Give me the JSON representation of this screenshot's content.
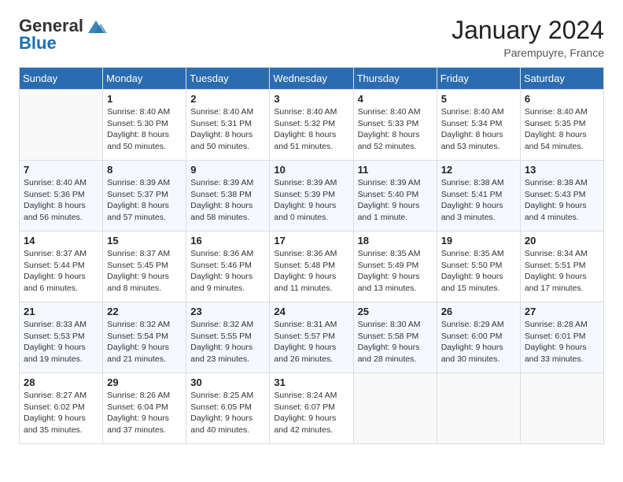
{
  "header": {
    "logo_general": "General",
    "logo_blue": "Blue",
    "month_year": "January 2024",
    "location": "Parempuyre, France"
  },
  "days_of_week": [
    "Sunday",
    "Monday",
    "Tuesday",
    "Wednesday",
    "Thursday",
    "Friday",
    "Saturday"
  ],
  "weeks": [
    [
      {
        "day": "",
        "sunrise": "",
        "sunset": "",
        "daylight": ""
      },
      {
        "day": "1",
        "sunrise": "Sunrise: 8:40 AM",
        "sunset": "Sunset: 5:30 PM",
        "daylight": "Daylight: 8 hours and 50 minutes."
      },
      {
        "day": "2",
        "sunrise": "Sunrise: 8:40 AM",
        "sunset": "Sunset: 5:31 PM",
        "daylight": "Daylight: 8 hours and 50 minutes."
      },
      {
        "day": "3",
        "sunrise": "Sunrise: 8:40 AM",
        "sunset": "Sunset: 5:32 PM",
        "daylight": "Daylight: 8 hours and 51 minutes."
      },
      {
        "day": "4",
        "sunrise": "Sunrise: 8:40 AM",
        "sunset": "Sunset: 5:33 PM",
        "daylight": "Daylight: 8 hours and 52 minutes."
      },
      {
        "day": "5",
        "sunrise": "Sunrise: 8:40 AM",
        "sunset": "Sunset: 5:34 PM",
        "daylight": "Daylight: 8 hours and 53 minutes."
      },
      {
        "day": "6",
        "sunrise": "Sunrise: 8:40 AM",
        "sunset": "Sunset: 5:35 PM",
        "daylight": "Daylight: 8 hours and 54 minutes."
      }
    ],
    [
      {
        "day": "7",
        "sunrise": "Sunrise: 8:40 AM",
        "sunset": "Sunset: 5:36 PM",
        "daylight": "Daylight: 8 hours and 56 minutes."
      },
      {
        "day": "8",
        "sunrise": "Sunrise: 8:39 AM",
        "sunset": "Sunset: 5:37 PM",
        "daylight": "Daylight: 8 hours and 57 minutes."
      },
      {
        "day": "9",
        "sunrise": "Sunrise: 8:39 AM",
        "sunset": "Sunset: 5:38 PM",
        "daylight": "Daylight: 8 hours and 58 minutes."
      },
      {
        "day": "10",
        "sunrise": "Sunrise: 8:39 AM",
        "sunset": "Sunset: 5:39 PM",
        "daylight": "Daylight: 9 hours and 0 minutes."
      },
      {
        "day": "11",
        "sunrise": "Sunrise: 8:39 AM",
        "sunset": "Sunset: 5:40 PM",
        "daylight": "Daylight: 9 hours and 1 minute."
      },
      {
        "day": "12",
        "sunrise": "Sunrise: 8:38 AM",
        "sunset": "Sunset: 5:41 PM",
        "daylight": "Daylight: 9 hours and 3 minutes."
      },
      {
        "day": "13",
        "sunrise": "Sunrise: 8:38 AM",
        "sunset": "Sunset: 5:43 PM",
        "daylight": "Daylight: 9 hours and 4 minutes."
      }
    ],
    [
      {
        "day": "14",
        "sunrise": "Sunrise: 8:37 AM",
        "sunset": "Sunset: 5:44 PM",
        "daylight": "Daylight: 9 hours and 6 minutes."
      },
      {
        "day": "15",
        "sunrise": "Sunrise: 8:37 AM",
        "sunset": "Sunset: 5:45 PM",
        "daylight": "Daylight: 9 hours and 8 minutes."
      },
      {
        "day": "16",
        "sunrise": "Sunrise: 8:36 AM",
        "sunset": "Sunset: 5:46 PM",
        "daylight": "Daylight: 9 hours and 9 minutes."
      },
      {
        "day": "17",
        "sunrise": "Sunrise: 8:36 AM",
        "sunset": "Sunset: 5:48 PM",
        "daylight": "Daylight: 9 hours and 11 minutes."
      },
      {
        "day": "18",
        "sunrise": "Sunrise: 8:35 AM",
        "sunset": "Sunset: 5:49 PM",
        "daylight": "Daylight: 9 hours and 13 minutes."
      },
      {
        "day": "19",
        "sunrise": "Sunrise: 8:35 AM",
        "sunset": "Sunset: 5:50 PM",
        "daylight": "Daylight: 9 hours and 15 minutes."
      },
      {
        "day": "20",
        "sunrise": "Sunrise: 8:34 AM",
        "sunset": "Sunset: 5:51 PM",
        "daylight": "Daylight: 9 hours and 17 minutes."
      }
    ],
    [
      {
        "day": "21",
        "sunrise": "Sunrise: 8:33 AM",
        "sunset": "Sunset: 5:53 PM",
        "daylight": "Daylight: 9 hours and 19 minutes."
      },
      {
        "day": "22",
        "sunrise": "Sunrise: 8:32 AM",
        "sunset": "Sunset: 5:54 PM",
        "daylight": "Daylight: 9 hours and 21 minutes."
      },
      {
        "day": "23",
        "sunrise": "Sunrise: 8:32 AM",
        "sunset": "Sunset: 5:55 PM",
        "daylight": "Daylight: 9 hours and 23 minutes."
      },
      {
        "day": "24",
        "sunrise": "Sunrise: 8:31 AM",
        "sunset": "Sunset: 5:57 PM",
        "daylight": "Daylight: 9 hours and 26 minutes."
      },
      {
        "day": "25",
        "sunrise": "Sunrise: 8:30 AM",
        "sunset": "Sunset: 5:58 PM",
        "daylight": "Daylight: 9 hours and 28 minutes."
      },
      {
        "day": "26",
        "sunrise": "Sunrise: 8:29 AM",
        "sunset": "Sunset: 6:00 PM",
        "daylight": "Daylight: 9 hours and 30 minutes."
      },
      {
        "day": "27",
        "sunrise": "Sunrise: 8:28 AM",
        "sunset": "Sunset: 6:01 PM",
        "daylight": "Daylight: 9 hours and 33 minutes."
      }
    ],
    [
      {
        "day": "28",
        "sunrise": "Sunrise: 8:27 AM",
        "sunset": "Sunset: 6:02 PM",
        "daylight": "Daylight: 9 hours and 35 minutes."
      },
      {
        "day": "29",
        "sunrise": "Sunrise: 8:26 AM",
        "sunset": "Sunset: 6:04 PM",
        "daylight": "Daylight: 9 hours and 37 minutes."
      },
      {
        "day": "30",
        "sunrise": "Sunrise: 8:25 AM",
        "sunset": "Sunset: 6:05 PM",
        "daylight": "Daylight: 9 hours and 40 minutes."
      },
      {
        "day": "31",
        "sunrise": "Sunrise: 8:24 AM",
        "sunset": "Sunset: 6:07 PM",
        "daylight": "Daylight: 9 hours and 42 minutes."
      },
      {
        "day": "",
        "sunrise": "",
        "sunset": "",
        "daylight": ""
      },
      {
        "day": "",
        "sunrise": "",
        "sunset": "",
        "daylight": ""
      },
      {
        "day": "",
        "sunrise": "",
        "sunset": "",
        "daylight": ""
      }
    ]
  ]
}
